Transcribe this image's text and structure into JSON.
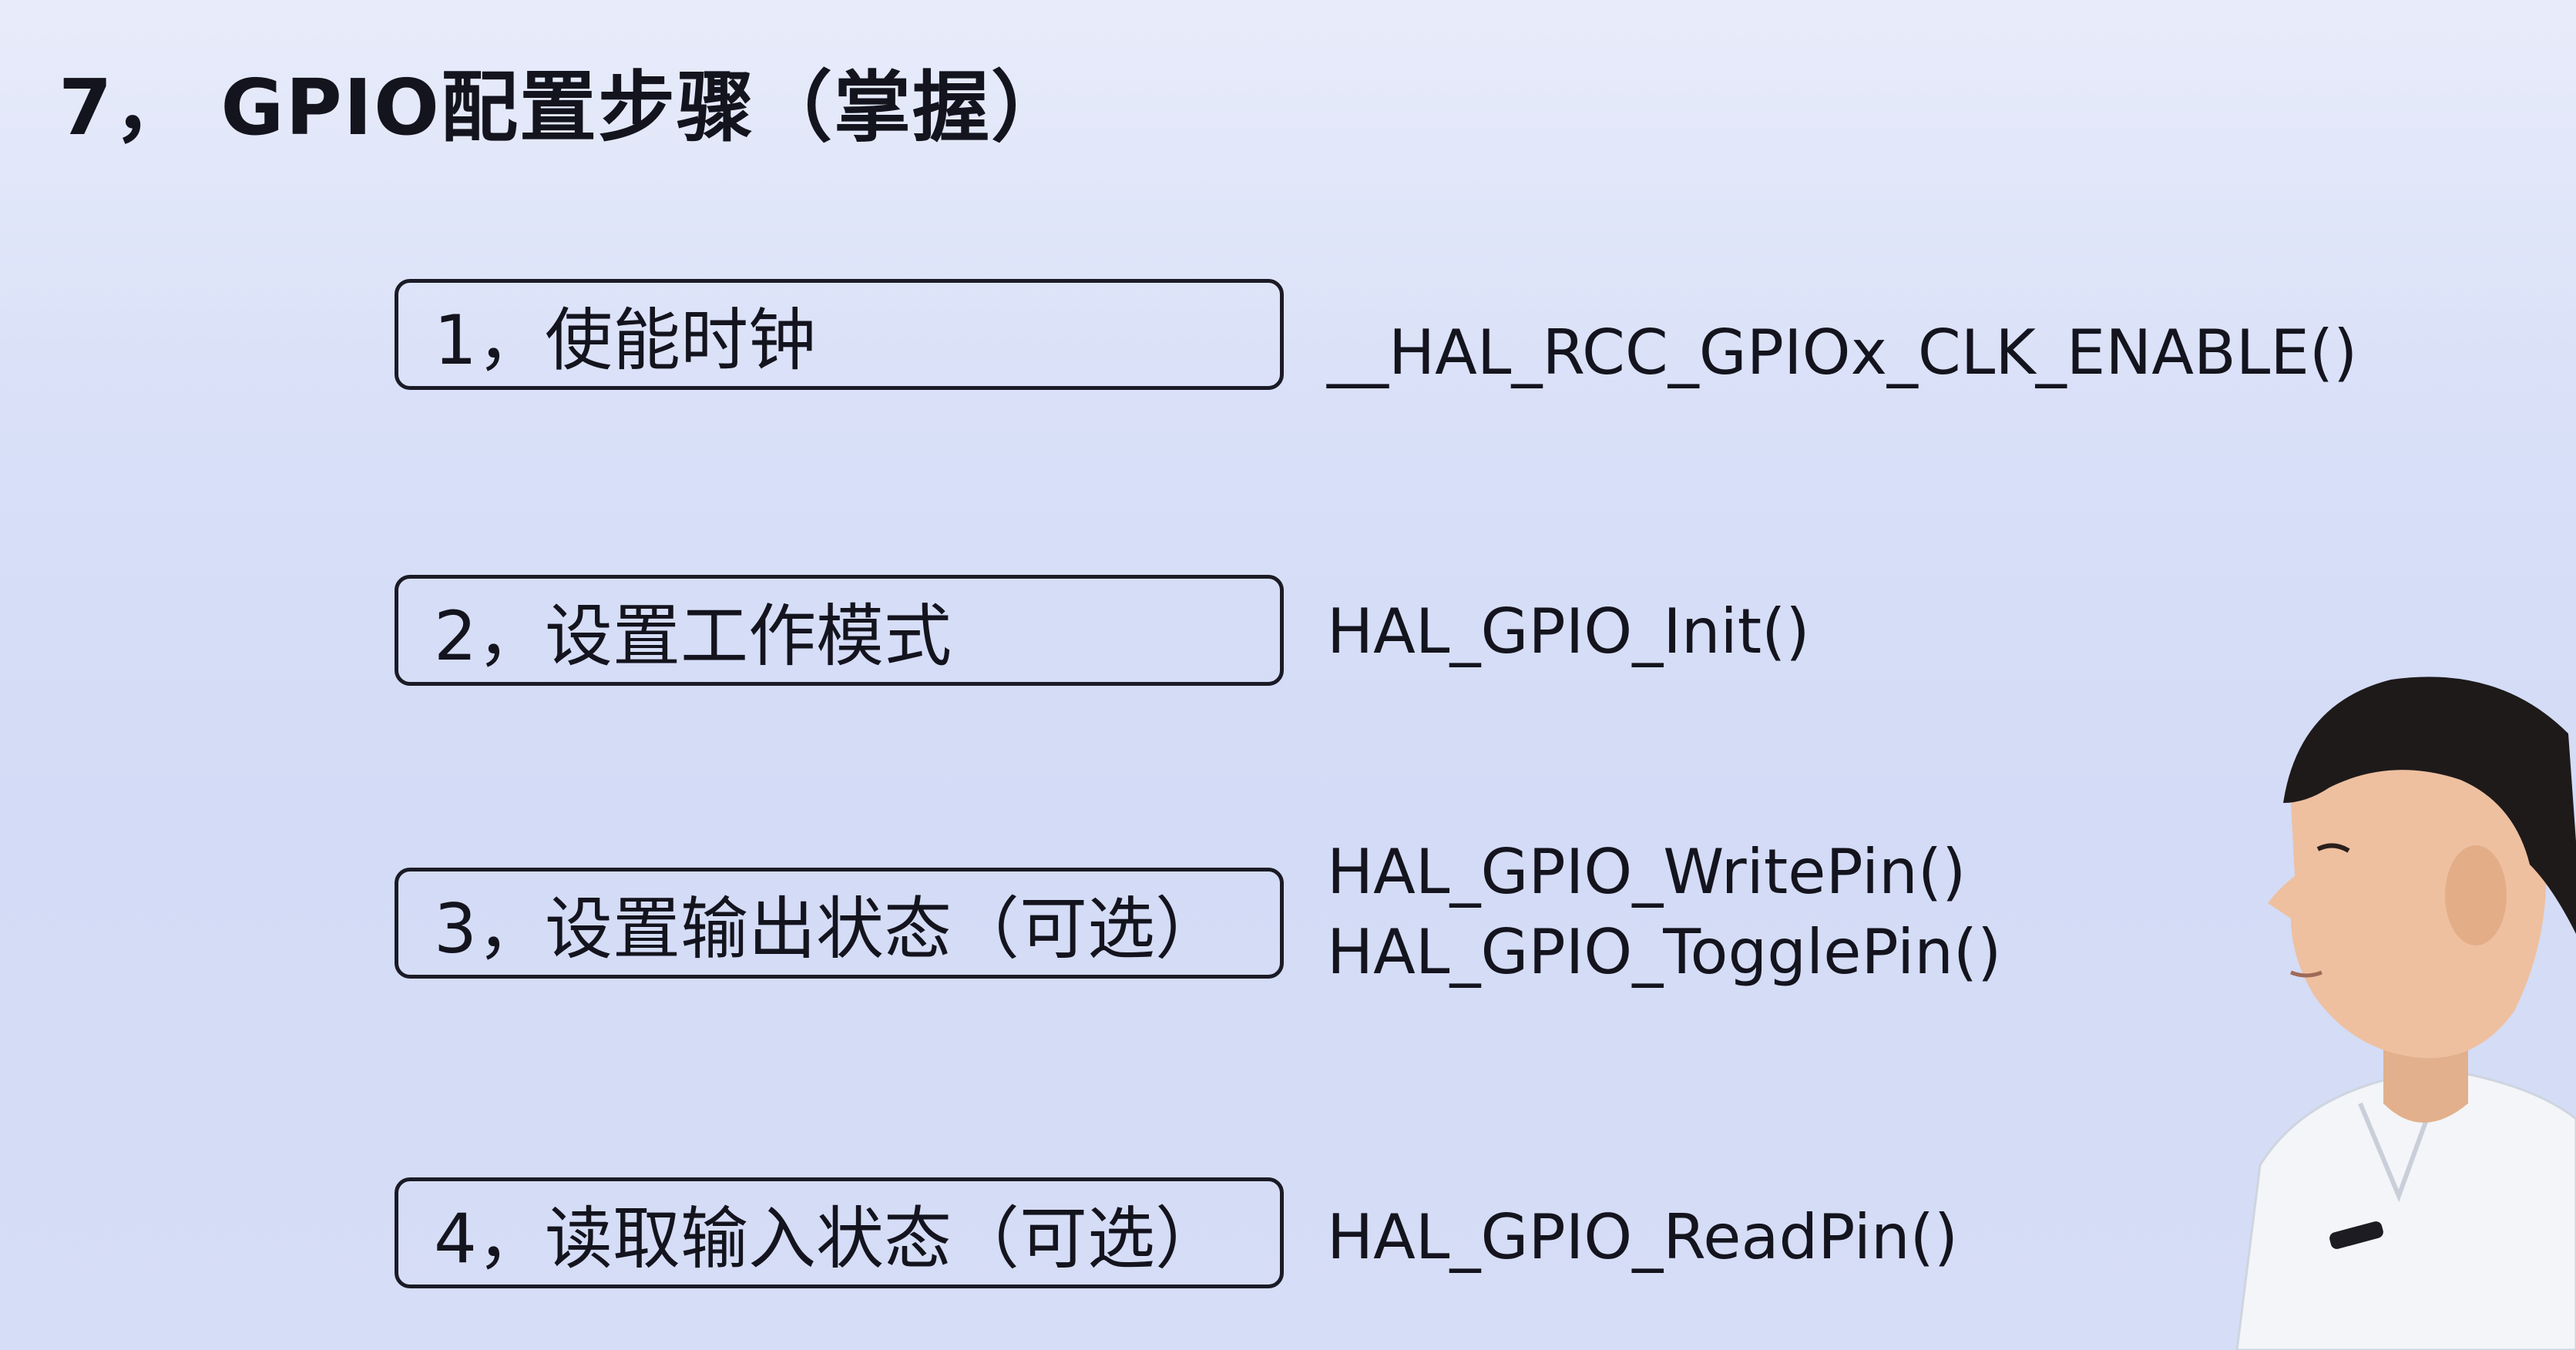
{
  "title": "7， GPIO配置步骤（掌握）",
  "steps": [
    {
      "label": "1，使能时钟",
      "functions": [
        "__HAL_RCC_GPIOx_CLK_ENABLE()"
      ]
    },
    {
      "label": "2，设置工作模式",
      "functions": [
        "HAL_GPIO_Init()"
      ]
    },
    {
      "label": "3，设置输出状态（可选）",
      "functions": [
        "HAL_GPIO_WritePin()",
        "HAL_GPIO_TogglePin()"
      ]
    },
    {
      "label": "4，读取输入状态（可选）",
      "functions": [
        "HAL_GPIO_ReadPin()"
      ]
    }
  ],
  "presenter": "presenter-figure"
}
